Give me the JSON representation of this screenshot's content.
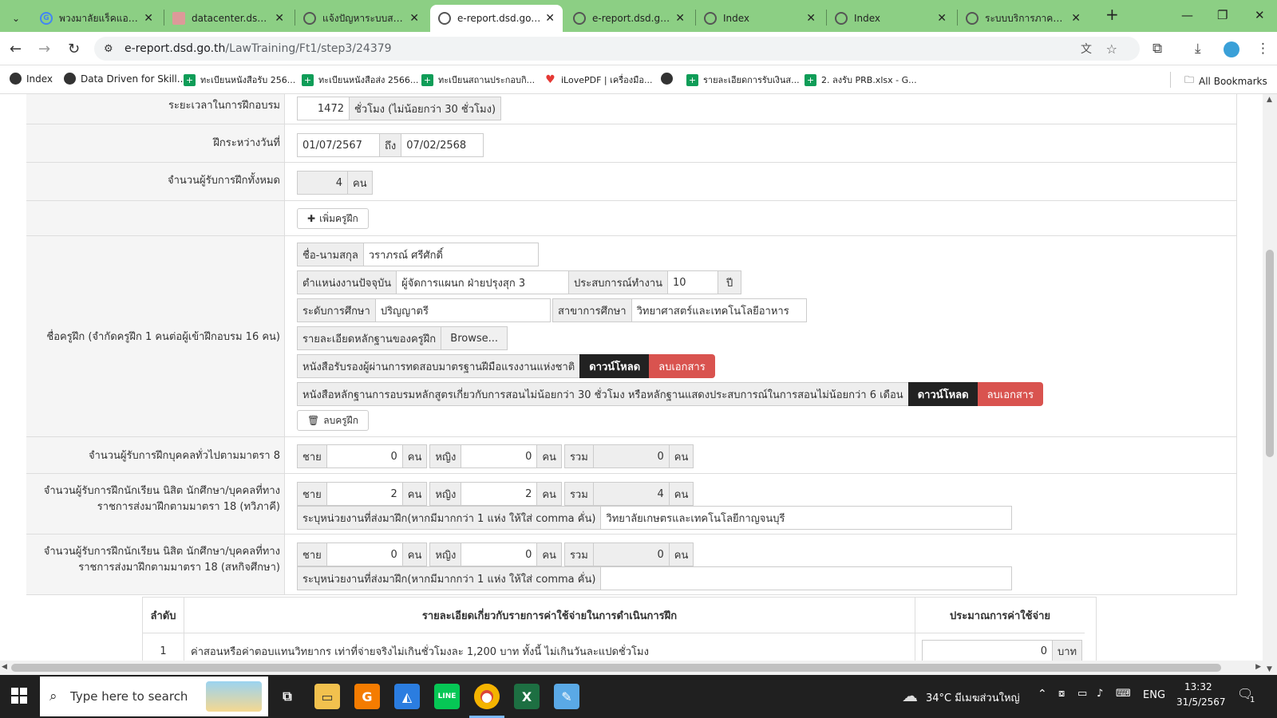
{
  "browser": {
    "tabs": [
      {
        "title": "พวงมาลัยแร็คแอนด์พิ",
        "fav": "G",
        "active": false
      },
      {
        "title": "datacenter.dsd.go",
        "fav": "",
        "active": false
      },
      {
        "title": "แจ้งปัญหาระบบสารสน",
        "fav": "",
        "active": false
      },
      {
        "title": "e-report.dsd.go.th",
        "fav": "",
        "active": true
      },
      {
        "title": "e-report.dsd.go.th",
        "fav": "",
        "active": false
      },
      {
        "title": "Index",
        "fav": "",
        "active": false
      },
      {
        "title": "Index",
        "fav": "",
        "active": false
      },
      {
        "title": "ระบบบริการภาครัฐแห่",
        "fav": "",
        "active": false
      }
    ],
    "url_host": "e-report.dsd.go.th",
    "url_path": "/LawTraining/Ft1/step3/24379",
    "bookmarks": [
      "Index",
      "Data Driven for Skill...",
      "ทะเบียนหนังสือรับ 256...",
      "ทะเบียนหนังสือส่ง 2566...",
      "ทะเบียนสถานประกอบกิ...",
      "iLovePDF | เครื่องมือ...",
      "",
      "รายละเอียดการรับเงินส...",
      "2. ลงรับ PRB.xlsx - G..."
    ],
    "all_bookmarks": "All Bookmarks"
  },
  "form": {
    "duration": {
      "label": "ระยะเวลาในการฝึกอบรม",
      "value": "1472",
      "unit": "ชั่วโมง (ไม่น้อยกว่า 30 ชั่วโมง)"
    },
    "period": {
      "label": "ฝึกระหว่างวันที่",
      "from": "01/07/2567",
      "to_label": "ถึง",
      "to": "07/02/2568"
    },
    "total_trainees": {
      "label": "จำนวนผู้รับการฝึกทั้งหมด",
      "value": "4",
      "unit": "คน"
    },
    "add_trainer": "เพิ่มครูฝึก",
    "trainer": {
      "section_label": "ชื่อครูฝึก (จำกัดครูฝึก 1 คนต่อผู้เข้าฝึกอบรม 16 คน)",
      "name_label": "ชื่อ-นามสกุล",
      "name": "วราภรณ์ ศรีศักดิ์",
      "position_label": "ตำแหน่งงานปัจจุบัน",
      "position": "ผู้จัดการแผนก ฝ่ายปรุงสุก 3",
      "experience_label": "ประสบการณ์ทำงาน",
      "experience": "10",
      "experience_unit": "ปี",
      "edu_level_label": "ระดับการศึกษา",
      "edu_level": "ปริญญาตรี",
      "edu_field_label": "สาขาการศึกษา",
      "edu_field": "วิทยาศาสตร์และเทคโนโลยีอาหาร",
      "evidence_label": "รายละเอียดหลักฐานของครูฝึก",
      "browse": "Browse...",
      "cert1_label": "หนังสือรับรองผู้ผ่านการทดสอบมาตรฐานฝีมือแรงงานแห่งชาติ",
      "cert2_label": "หนังสือหลักฐานการอบรมหลักสูตรเกี่ยวกับการสอนไม่น้อยกว่า 30 ชั่วโมง หรือหลักฐานแสดงประสบการณ์ในการสอนไม่น้อยกว่า 6 เดือน",
      "download": "ดาวน์โหลด",
      "delete_doc": "ลบเอกสาร",
      "delete_trainer": "ลบครูฝึก"
    },
    "labels": {
      "male": "ชาย",
      "female": "หญิง",
      "total": "รวม",
      "person": "คน",
      "agency_label": "ระบุหน่วยงานที่ส่งมาฝึก(หากมีมากกว่า 1 แห่ง ให้ใส่ comma คั่น)"
    },
    "general": {
      "label": "จำนวนผู้รับการฝึกบุคคลทั่วไปตามมาตรา 8",
      "male": "0",
      "female": "0",
      "total": "0"
    },
    "dual": {
      "label": "จำนวนผู้รับการฝึกนักเรียน นิสิต นักศึกษา/บุคคลที่ทางราชการส่งมาฝึกตามมาตรา 18 (ทวิภาคี)",
      "male": "2",
      "female": "2",
      "total": "4",
      "agency": "วิทยาลัยเกษตรและเทคโนโลยีกาญจนบุรี"
    },
    "coop": {
      "label": "จำนวนผู้รับการฝึกนักเรียน นิสิต นักศึกษา/บุคคลที่ทางราชการส่งมาฝึกตามมาตรา 18 (สหกิจศึกษา)",
      "male": "0",
      "female": "0",
      "total": "0",
      "agency": ""
    }
  },
  "table": {
    "headers": [
      "ลำดับ",
      "รายละเอียดเกี่ยวกับรายการค่าใช้จ่ายในการดำเนินการฝึก",
      "ประมาณการค่าใช้จ่าย"
    ],
    "rows": [
      {
        "no": "1",
        "detail": "ค่าสอนหรือค่าตอบแทนวิทยากร เท่าที่จ่ายจริงไม่เกินชั่วโมงละ 1,200 บาท ทั้งนี้ ไม่เกินวันละแปดชั่วโมง",
        "amount": "0",
        "unit": "บาท"
      }
    ]
  },
  "taskbar": {
    "search_placeholder": "Type here to search",
    "weather": "34°C  มีเมฆส่วนใหญ่",
    "lang": "ENG",
    "time": "13:32",
    "date": "31/5/2567",
    "notif": "1"
  },
  "colors": {
    "tabbar": "#8ccf84",
    "dark_btn": "#222222",
    "red_btn": "#d9534f"
  }
}
